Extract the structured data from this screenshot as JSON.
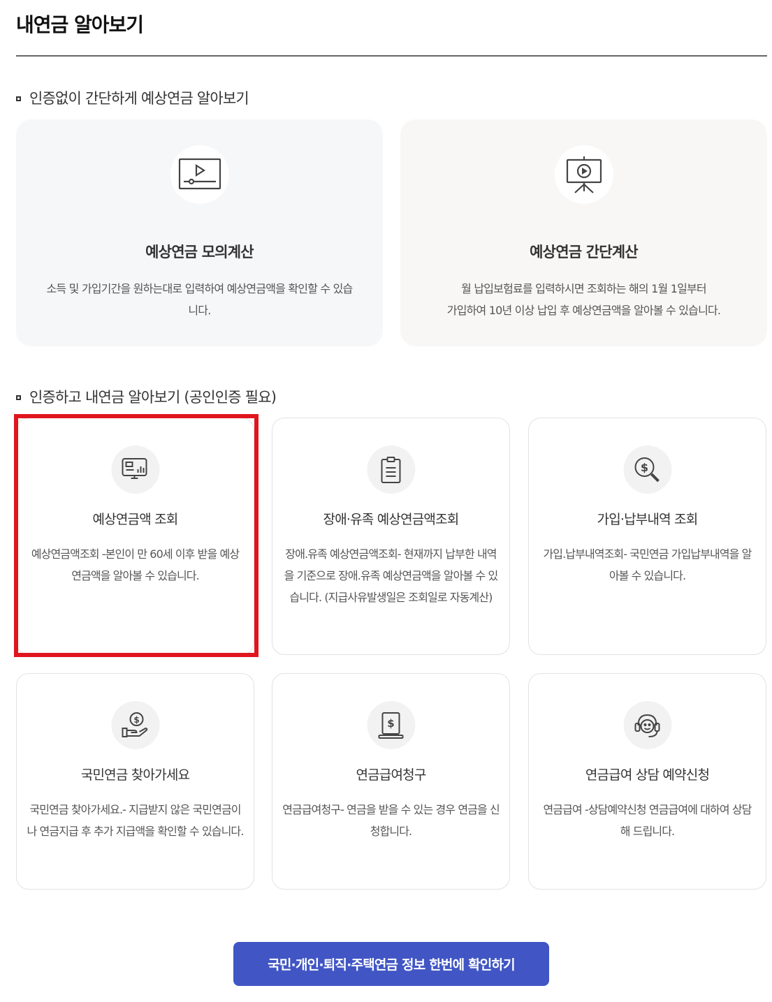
{
  "page": {
    "title": "내연금 알아보기"
  },
  "section_no_auth": {
    "heading": "인증없이 간단하게 예상연금 알아보기",
    "cards": [
      {
        "title": "예상연금 모의계산",
        "desc": "소득 및 가입기간을 원하는대로 입력하여 예상연금액을 확인할 수 있습니다.",
        "icon": "video-player-icon"
      },
      {
        "title": "예상연금 간단계산",
        "desc_line1": "월 납입보험료를 입력하시면 조회하는 해의 1월 1일부터",
        "desc_line2": "가입하여 10년 이상 납입 후 예상연금액을 알아볼 수 있습니다.",
        "icon": "presentation-board-icon"
      }
    ]
  },
  "section_auth": {
    "heading": "인증하고 내연금 알아보기 (공인인증 필요)",
    "cards": [
      {
        "title": "예상연금액 조회",
        "desc": "예상연금액조회 -본인이 만 60세 이후 받을 예상연금액을 알아볼 수 있습니다.",
        "icon": "monitor-chart-icon"
      },
      {
        "title": "장애·유족 예상연금액조회",
        "desc": "장애.유족 예상연금액조회- 현재까지 납부한 내역을 기준으로 장애.유족 예상연금액을 알아볼 수 있습니다. (지급사유발생일은 조회일로 자동계산)",
        "icon": "clipboard-list-icon"
      },
      {
        "title": "가입·납부내역 조회",
        "desc": "가입.납부내역조회- 국민연금 가입납부내역을 알아볼 수 있습니다.",
        "icon": "dollar-search-icon"
      },
      {
        "title": "국민연금 찾아가세요",
        "desc": "국민연금 찾아가세요.- 지급받지 않은 국민연금이나 연금지급 후 추가 지급액을 확인할 수 있습니다.",
        "icon": "hand-coin-icon"
      },
      {
        "title": "연금급여청구",
        "desc": "연금급여청구- 연금을 받을 수 있는 경우 연금을 신청합니다.",
        "icon": "dollar-document-icon"
      },
      {
        "title": "연금급여 상담 예약신청",
        "desc": "연금급여 -상담예약신청 연금급여에 대하여 상담해 드립니다.",
        "icon": "headset-icon"
      }
    ]
  },
  "cta": {
    "label": "국민·개인·퇴직·주택연금 정보 한번에 확인하기"
  },
  "colors": {
    "accent": "#4156c4",
    "highlight": "#e0161e"
  }
}
